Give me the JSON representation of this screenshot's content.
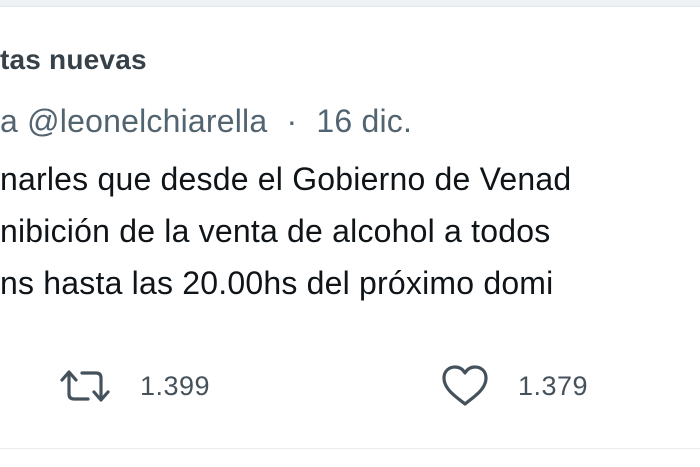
{
  "section": {
    "title": "tas nuevas"
  },
  "tweet": {
    "handle_prefix": "a",
    "handle": "@leonelchiarella",
    "separator": "·",
    "date": "16 dic.",
    "lines": [
      "narles que desde el Gobierno de Venad",
      "nibición de la venta de alcohol a todos",
      "ns hasta las 20.00hs del próximo domi"
    ]
  },
  "actions": {
    "retweet": {
      "icon": "retweet-icon",
      "count": "1.399"
    },
    "like": {
      "icon": "heart-icon",
      "count": "1.379"
    }
  },
  "colors": {
    "text": "#0f1419",
    "secondary": "#536471",
    "header": "#36414a",
    "icon": "#45525c"
  }
}
